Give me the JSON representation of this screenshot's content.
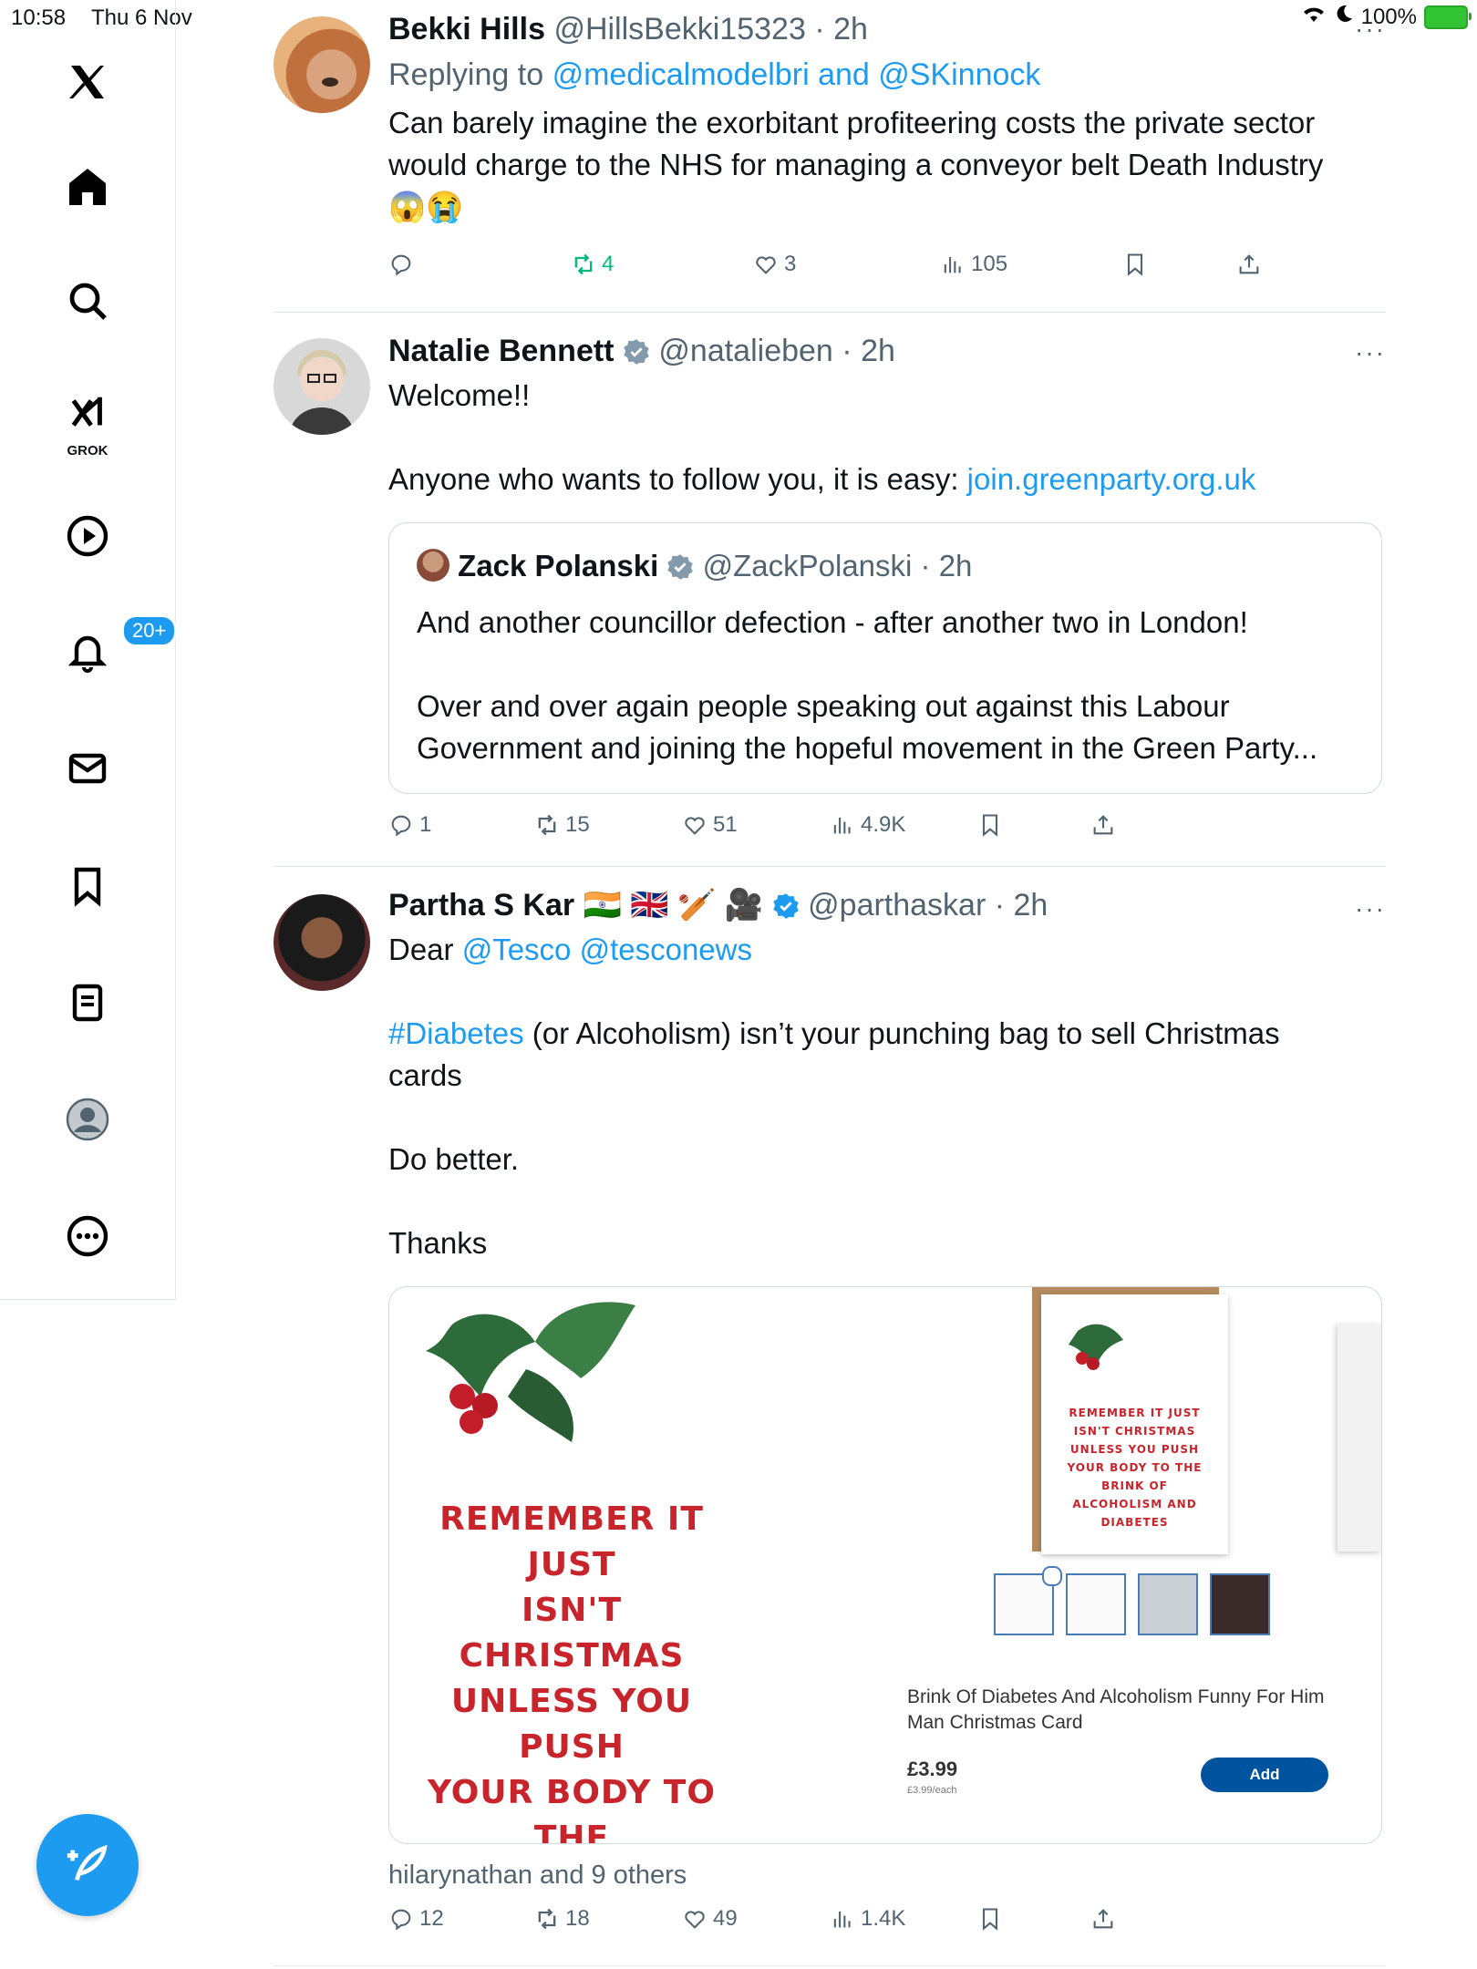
{
  "status": {
    "time": "10:58",
    "date": "Thu 6 Nov",
    "battery": "100%"
  },
  "sidebar": {
    "grok_label": "GROK",
    "notifications_badge": "20+"
  },
  "tweets": [
    {
      "name": "Bekki Hills",
      "handle": "@HillsBekki15323",
      "time": "· 2h",
      "replying_prefix": "Replying to",
      "replying_to": "@medicalmodelbri and @SKinnock",
      "text": "Can barely imagine the exorbitant profiteering costs the private sector would charge to the NHS for managing a conveyor belt Death Industry",
      "emojis": "😱😭",
      "stats": {
        "replies": "",
        "retweets": "4",
        "likes": "3",
        "views": "105"
      }
    },
    {
      "name": "Natalie Bennett",
      "handle": "@natalieben",
      "time": "· 2h",
      "text1": "Welcome!!",
      "text2": "Anyone who wants to follow you, it is easy:",
      "link": "join.greenparty.org.uk",
      "quote": {
        "name": "Zack Polanski",
        "handle": "@ZackPolanski",
        "time": "· 2h",
        "text1": "And another councillor defection - after another two in London!",
        "text2": "Over and over again people speaking out against this Labour Government and joining the hopeful movement in the Green Party..."
      },
      "stats": {
        "replies": "1",
        "retweets": "15",
        "likes": "51",
        "views": "4.9K"
      }
    },
    {
      "name": "Partha S Kar",
      "flags": "🇮🇳 🇬🇧 🏏 🎥",
      "handle": "@parthaskar",
      "time": "· 2h",
      "dear": "Dear",
      "mentions": "@Tesco @tesconews",
      "hashtag": "#Diabetes",
      "text1": "(or Alcoholism) isn’t your punching bag to sell Christmas cards",
      "text2": "Do better.",
      "text3": "Thanks",
      "media": {
        "card_text": [
          "REMEMBER IT JUST",
          "ISN'T CHRISTMAS",
          "UNLESS YOU PUSH",
          "YOUR BODY TO THE",
          "BRINK OF",
          "ALCOHOLISM AND",
          "DIABETES"
        ],
        "product_title": "Brink Of Diabetes And Alcoholism Funny For Him Man Christmas Card",
        "price": "£3.99",
        "price_each": "£3.99/each",
        "add_label": "Add"
      },
      "liked_by": "hilarynathan and 9 others",
      "stats": {
        "replies": "12",
        "retweets": "18",
        "likes": "49",
        "views": "1.4K"
      }
    }
  ],
  "colors": {
    "accent": "#1d9bf0",
    "retweet_green": "#00ba7c",
    "card_red": "#c8242b",
    "muted": "#536471"
  }
}
